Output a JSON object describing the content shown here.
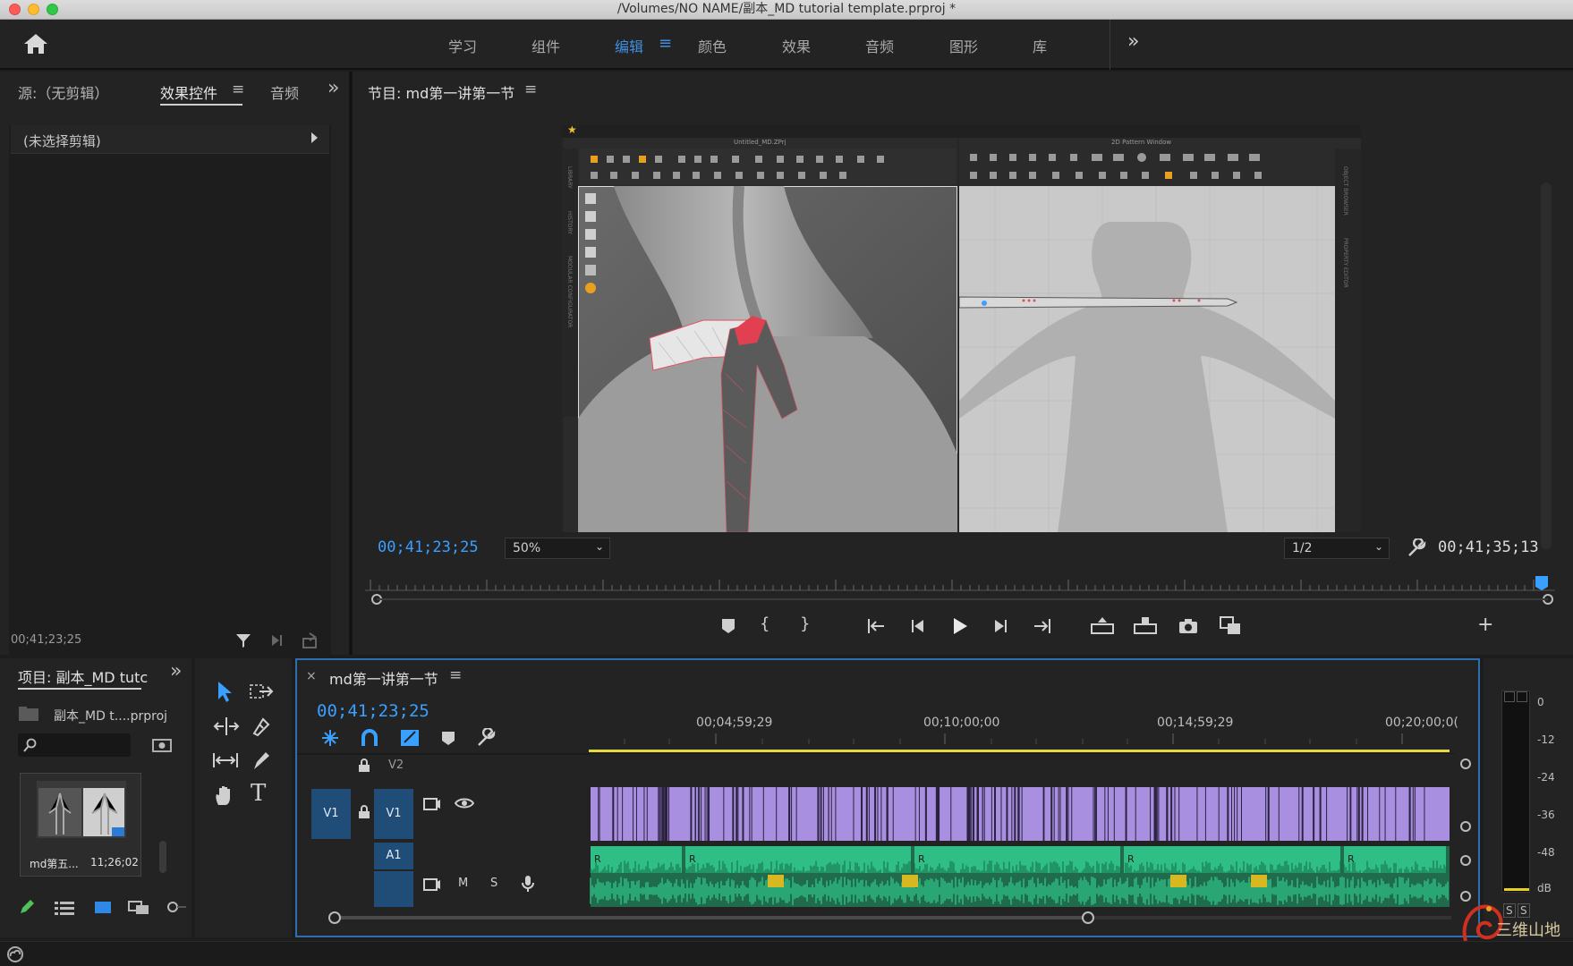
{
  "window": {
    "title": "/Volumes/NO NAME/副本_MD tutorial template.prproj *"
  },
  "workspaces": [
    "学习",
    "组件",
    "编辑",
    "颜色",
    "效果",
    "音频",
    "图形",
    "库"
  ],
  "workspace_active": "编辑",
  "left_panel": {
    "tabs": {
      "source": "源:（无剪辑）",
      "effect_controls": "效果控件",
      "audio": "音频"
    },
    "no_clip": "(未选择剪辑)",
    "timecode": "00;41;23;25"
  },
  "program": {
    "title": "节目: md第一讲第一节",
    "timecode_current": "00;41;23;25",
    "zoom": "50%",
    "resolution": "1/2",
    "timecode_duration": "00;41;35;13",
    "video": {
      "left_window_title": "Untitled_MD.ZPrj",
      "right_window_title": "2D Pattern Window",
      "side_labels": [
        "LIBRARY",
        "HISTORY",
        "MODULAR CONFIGURATOR"
      ],
      "right_side_labels": [
        "OBJECT BROWSER",
        "PROPERTY EDITOR"
      ]
    }
  },
  "project": {
    "tab": "项目: 副本_MD tutc",
    "file": "副本_MD t....prproj",
    "item_name": "md第五...",
    "item_duration": "11;26;02"
  },
  "timeline": {
    "name": "md第一讲第一节",
    "timecode": "00;41;23;25",
    "ruler": [
      "00;04;59;29",
      "00;10;00;00",
      "00;14;59;29",
      "00;20;00;0("
    ],
    "tracks": {
      "v2": "V2",
      "v1_src": "V1",
      "v1": "V1",
      "a1": "A1",
      "mute": "M",
      "solo": "S"
    },
    "colors": {
      "video_clip": "#a98fe0",
      "audio_clip": "#2fbf86",
      "selected": "#3aa0ff"
    }
  },
  "meter": {
    "scale": [
      "0",
      "-12",
      "-24",
      "-36",
      "-48",
      "dB"
    ],
    "solo": [
      "S",
      "S"
    ]
  },
  "watermark": "三维山地"
}
